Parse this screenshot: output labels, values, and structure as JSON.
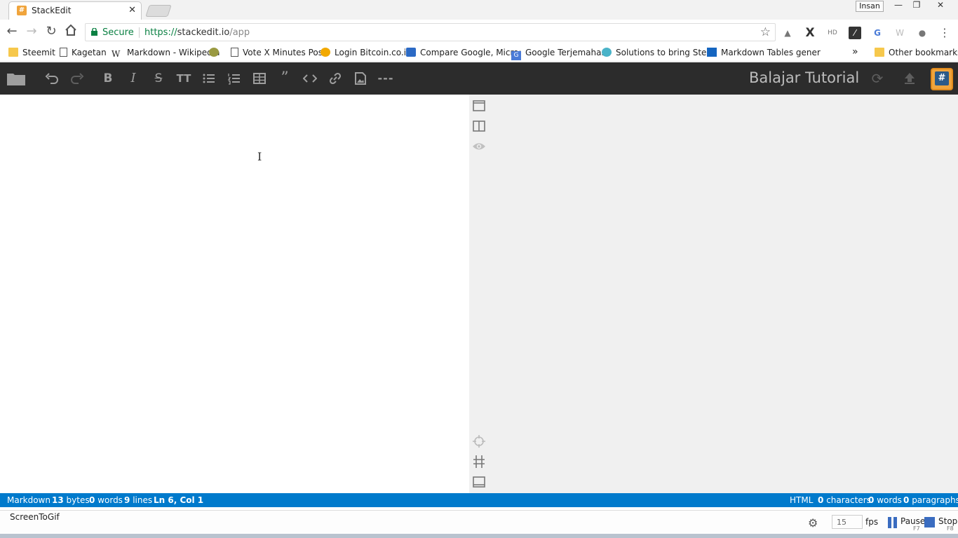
{
  "browser": {
    "tab_title": "StackEdit",
    "tab_close": "✕",
    "profile_label": "Insan",
    "address": {
      "secure_label": "Secure",
      "url_scheme": "https://",
      "url_host": "stackedit.io",
      "url_path": "/app"
    },
    "bookmarks": [
      {
        "label": "Steemit",
        "icon": "folder-icon"
      },
      {
        "label": "Kagetan",
        "icon": "page-icon"
      },
      {
        "label": "Markdown - Wikipedia",
        "icon": "wikipedia-icon"
      },
      {
        "label": "",
        "icon": "pepe-icon"
      },
      {
        "label": "Vote X Minutes Post",
        "icon": "page-icon"
      },
      {
        "label": "Login Bitcoin.co.id",
        "icon": "bitcoin-icon"
      },
      {
        "label": "Compare Google, Micro:",
        "icon": "compare-icon"
      },
      {
        "label": "Google Terjemahan",
        "icon": "google-translate-icon"
      },
      {
        "label": "Solutions to bring Steen",
        "icon": "steem-icon"
      },
      {
        "label": "Markdown Tables gener",
        "icon": "tables-icon"
      }
    ],
    "more_bookmarks": "»",
    "other_bookmarks": "Other bookmarks"
  },
  "stackedit": {
    "title": "Balajar Tutorial",
    "avatar_glyph": "#"
  },
  "status": {
    "left": {
      "mode": "Markdown",
      "bytes_value": "13",
      "bytes_label": "bytes",
      "words_value": "0",
      "words_label": "words",
      "lines_value": "9",
      "lines_label": "lines",
      "position": "Ln 6, Col 1"
    },
    "right": {
      "mode": "HTML",
      "chars_value": "0",
      "chars_label": "characters",
      "words_value": "0",
      "words_label": "words",
      "paras_value": "0",
      "paras_label": "paragraphs"
    }
  },
  "recorder": {
    "title": "ScreenToGif",
    "fps_value": "15",
    "fps_label": "fps",
    "pause_label": "Pause",
    "pause_key": "F7",
    "stop_label": "Stop",
    "stop_key": "F8"
  },
  "colors": {
    "accent": "#007acc",
    "navbar": "#2c2c2c",
    "preview_bg": "#f0f0f0",
    "brand_orange": "#f0a43c"
  }
}
